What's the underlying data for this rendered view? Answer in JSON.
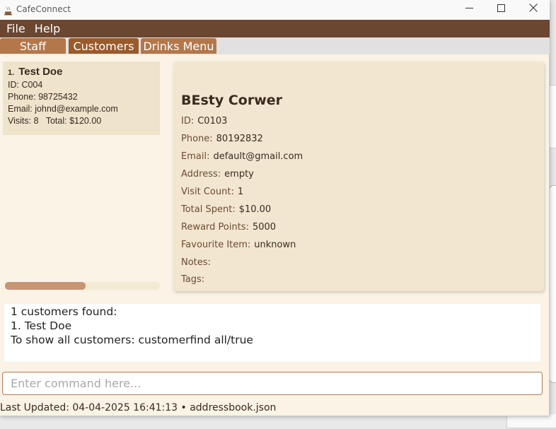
{
  "window": {
    "title": "CafeConnect",
    "app_icon": "coffee-cup-icon",
    "controls": {
      "minimize": "minimize-icon",
      "maximize": "maximize-icon",
      "close": "close-icon"
    }
  },
  "menubar": {
    "items": [
      "File",
      "Help"
    ]
  },
  "tabs": [
    {
      "label": "Staff",
      "selected": false
    },
    {
      "label": "Customers",
      "selected": true
    },
    {
      "label": "Drinks Menu",
      "selected": false
    }
  ],
  "customer_list": [
    {
      "index": "1.",
      "name": "Test Doe",
      "id": "ID: C004",
      "phone": "Phone: 98725432",
      "email": "Email: johnd@example.com",
      "visits_total": "Visits: 8   Total: $120.00"
    }
  ],
  "details": {
    "name": "BEsty Corwer",
    "rows": [
      {
        "label": "ID:",
        "value": "C0103"
      },
      {
        "label": "Phone:",
        "value": "80192832"
      },
      {
        "label": "Email:",
        "value": "default@gmail.com"
      },
      {
        "label": "Address:",
        "value": "empty"
      },
      {
        "label": "Visit Count:",
        "value": "1"
      },
      {
        "label": "Total Spent:",
        "value": "$10.00"
      },
      {
        "label": "Reward Points:",
        "value": "5000"
      },
      {
        "label": "Favourite Item:",
        "value": "unknown"
      },
      {
        "label": "Notes:",
        "value": ""
      },
      {
        "label": "Tags:",
        "value": ""
      }
    ]
  },
  "result": {
    "lines": [
      "1 customers found:",
      "1. Test Doe",
      "To show all customers: customerfind all/true"
    ]
  },
  "command": {
    "placeholder": "Enter command here...",
    "value": ""
  },
  "status": {
    "text": "Last Updated: 04-04-2025 16:41:13 • addressbook.json"
  },
  "colors": {
    "menubar": "#6b4631",
    "tab": "#b4774a",
    "tab_selected": "#9a5a2a",
    "card": "#efe3cc",
    "details": "#f2e6d0",
    "scroll_thumb": "#c69574"
  },
  "list_scroll_fraction": 0.52
}
